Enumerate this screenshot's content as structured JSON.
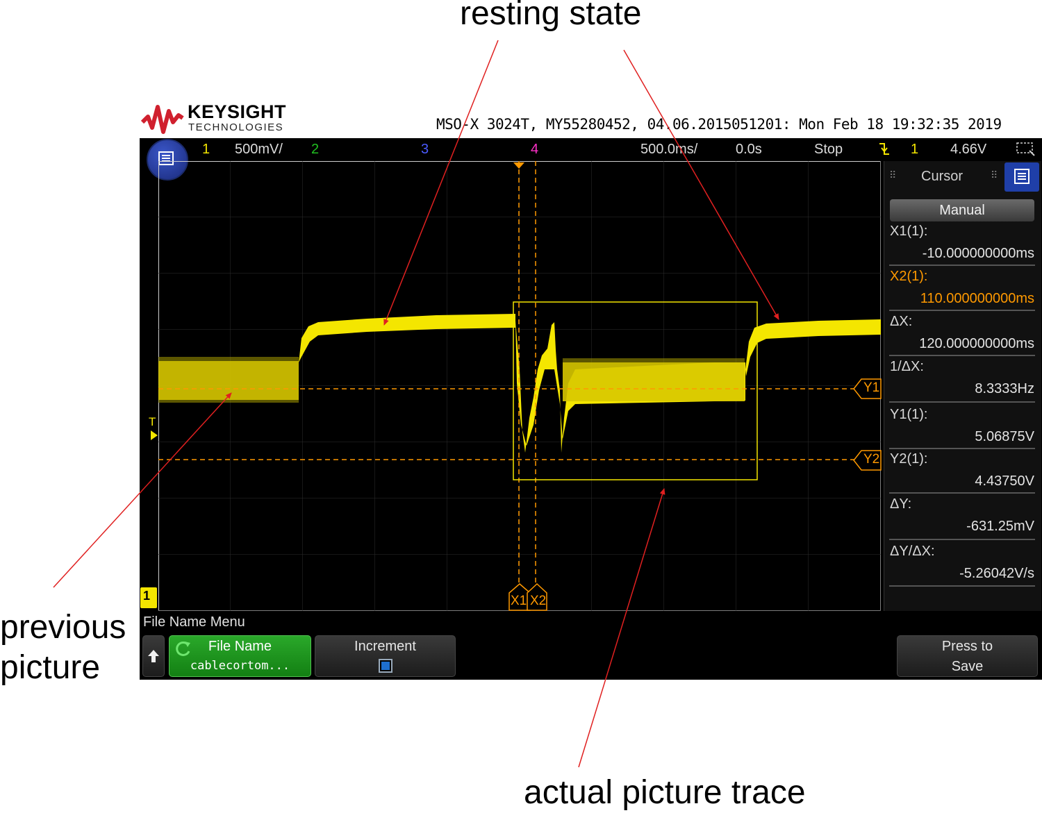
{
  "annotations": {
    "resting_state": "resting state",
    "previous_picture_line1": "previous",
    "previous_picture_line2": "picture",
    "actual_picture_trace": "actual picture trace"
  },
  "brand": {
    "name": "KEYSIGHT",
    "sub": "TECHNOLOGIES",
    "logo_icon": "keysight-wave-icon",
    "color": "#d0202e"
  },
  "header": {
    "info": "MSO-X 3024T, MY55280452, 04.06.2015051201: Mon Feb 18 19:32:35 2019"
  },
  "topbar": {
    "ch1_num": "1",
    "ch1_scale": "500mV/",
    "ch2_num": "2",
    "ch3_num": "3",
    "ch4_num": "4",
    "timebase": "500.0ms/",
    "delay": "0.0s",
    "run_state": "Stop",
    "trigger_icon": "falling-edge-trigger-icon",
    "trigger_source": "1",
    "trigger_level": "4.66V",
    "zoom_icon": "zoom-box-icon"
  },
  "colors": {
    "ch1": "#f4e600",
    "ch2": "#20c020",
    "ch3": "#4a5aff",
    "ch4": "#ff30c8",
    "cursor": "#ff9900"
  },
  "markers": {
    "y1": "Y1",
    "y2": "Y2",
    "x1": "X1",
    "x2": "X2",
    "trigger_t": "T",
    "ch1_ground": "1"
  },
  "cursor_panel": {
    "title": "Cursor",
    "mode": "Manual",
    "x1_label": "X1(1):",
    "x1_value": "-10.000000000ms",
    "x2_label": "X2(1):",
    "x2_value": "110.000000000ms",
    "dx_label": "ΔX:",
    "dx_value": "120.000000000ms",
    "inv_dx_label": "1/ΔX:",
    "inv_dx_value": "8.3333Hz",
    "y1_label": "Y1(1):",
    "y1_value": "5.06875V",
    "y2_label": "Y2(1):",
    "y2_value": "4.43750V",
    "dy_label": "ΔY:",
    "dy_value": "-631.25mV",
    "dydx_label": "ΔY/ΔX:",
    "dydx_value": "-5.26042V/s"
  },
  "softkeys": {
    "menu_title": "File Name Menu",
    "back_icon": "up-arrow-icon",
    "file_name_label": "File Name",
    "file_name_value": "cablecortom...",
    "refresh_icon": "refresh-icon",
    "increment_label": "Increment",
    "save_line1": "Press to",
    "save_line2": "Save"
  }
}
